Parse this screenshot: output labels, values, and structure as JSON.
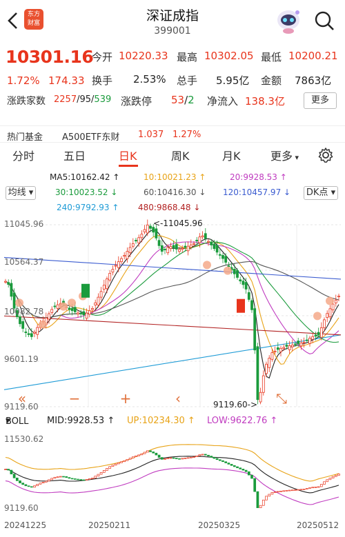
{
  "header": {
    "title": "深证成指",
    "code": "399001",
    "logo_text_1": "东方",
    "logo_text_2": "财富"
  },
  "quote": {
    "price": "10301.16",
    "pct": "1.72%",
    "change": "174.33",
    "open_label": "今开",
    "open": "10220.33",
    "high_label": "最高",
    "high": "10302.05",
    "low_label": "最低",
    "low": "10200.21",
    "turnover_label": "换手",
    "turnover": "2.53%",
    "volume_label": "总手",
    "volume": "5.95亿",
    "amount_label": "金额",
    "amount": "7863亿",
    "breadth_label": "涨跌家数",
    "breadth_up": "2257",
    "breadth_flat": "95",
    "breadth_down": "539",
    "limit_label": "涨跌停",
    "limit_up": "53",
    "limit_down": "2",
    "inflow_label": "净流入",
    "inflow": "138.3亿",
    "more": "更多"
  },
  "hot_fund": {
    "label": "热门基金",
    "name": "A500ETF东财",
    "price": "1.037",
    "pct": "1.27%"
  },
  "tabs": {
    "items": [
      "分时",
      "五日",
      "日K",
      "周K",
      "月K",
      "更多"
    ],
    "active": "日K"
  },
  "ma_legend": {
    "ma5": "MA5:10162.42 ↑",
    "ma10": "10:10021.23 ↑",
    "ma20": "20:9928.53 ↑",
    "ma30": "30:10023.52 ↓",
    "ma60": "60:10416.30 ↓",
    "ma120": "120:10457.97 ↓",
    "ma240": "240:9792.93 ↑",
    "ma480": "480:9868.48 ↓",
    "colors": {
      "ma5": "#222222",
      "ma10": "#e8a317",
      "ma20": "#c03cc0",
      "ma30": "#1a9b3c",
      "ma60": "#555555",
      "ma120": "#3a5bd0",
      "ma240": "#1e9bd6",
      "ma480": "#b22222"
    }
  },
  "chart_controls": {
    "avg_line": "均线",
    "dk_point": "DK点"
  },
  "axis": {
    "y_labels": [
      "11045.96",
      "10564.37",
      "10082.78",
      "9601.19",
      "9119.60"
    ],
    "max_marker": "11045.96",
    "min_marker": "9119.60->"
  },
  "boll": {
    "label": "BOLL",
    "mid": "MID:9928.53 ↑",
    "up": "UP:10234.30 ↑",
    "low": "LOW:9622.76 ↑",
    "y_top": "11530.62",
    "y_bottom": "9119.60"
  },
  "dates": [
    "20241225",
    "20250211",
    "20250325",
    "20250512"
  ],
  "chart_data": {
    "type": "candlestick",
    "ylim": [
      9119.6,
      11045.96
    ],
    "y_ticks": [
      11045.96,
      10564.37,
      10082.78,
      9601.19,
      9119.6
    ],
    "x_ticks": [
      "20241225",
      "20250211",
      "20250325",
      "20250512"
    ],
    "last_close": 10301.16,
    "high_point": 11045.96,
    "low_point": 9119.6,
    "indicators": {
      "MA5": 10162.42,
      "MA10": 10021.23,
      "MA20": 9928.53,
      "MA30": 10023.52,
      "MA60": 10416.3,
      "MA120": 10457.97,
      "MA240": 9792.93,
      "MA480": 9868.48
    },
    "boll": {
      "MID": 9928.53,
      "UP": 10234.3,
      "LOW": 9622.76
    }
  }
}
